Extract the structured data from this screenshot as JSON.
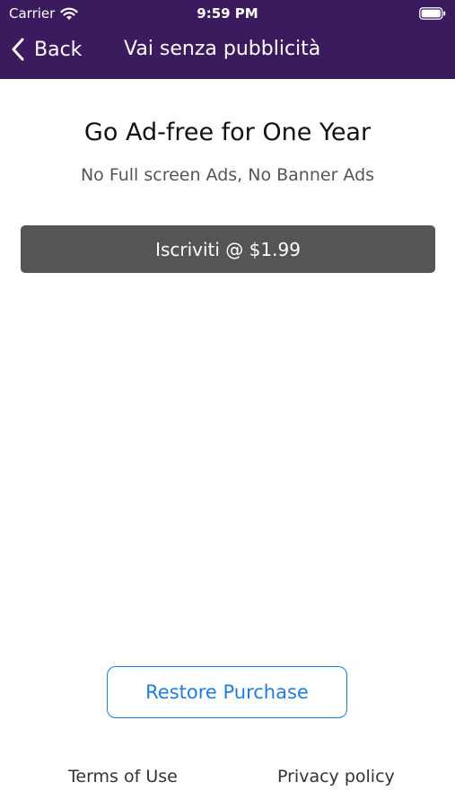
{
  "status_bar": {
    "carrier": "Carrier",
    "time": "9:59 PM",
    "wifi_icon": "wifi-icon",
    "battery_icon": "battery-icon"
  },
  "nav": {
    "back_label": "Back",
    "back_icon": "chevron-left-icon",
    "title": "Vai senza pubblicità",
    "background_color": "#3b1a5e"
  },
  "offer": {
    "headline": "Go Ad-free for One Year",
    "subhead": "No Full screen Ads, No Banner Ads",
    "subscribe_label": "Iscriviti @ $1.99",
    "subscribe_color": "#555555"
  },
  "restore": {
    "label": "Restore Purchase",
    "accent_color": "#1a7ee5"
  },
  "footer": {
    "terms_label": "Terms of Use",
    "privacy_label": "Privacy policy"
  }
}
